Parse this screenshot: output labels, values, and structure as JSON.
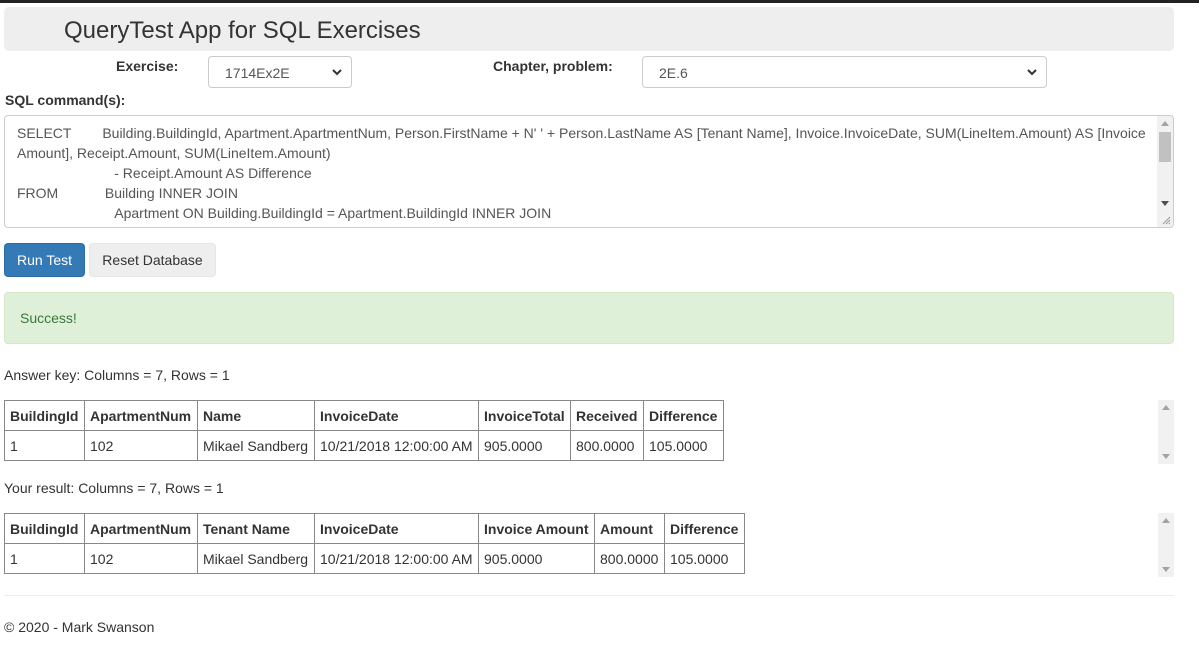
{
  "app": {
    "title": "QueryTest App for SQL Exercises"
  },
  "exercise": {
    "label": "Exercise:",
    "selected": "1714Ex2E"
  },
  "chapter": {
    "label": "Chapter, problem:",
    "selected": "2E.6"
  },
  "sql": {
    "label": "SQL command(s):",
    "text": "SELECT        Building.BuildingId, Apartment.ApartmentNum, Person.FirstName + N' ' + Person.LastName AS [Tenant Name], Invoice.InvoiceDate, SUM(LineItem.Amount) AS [Invoice Amount], Receipt.Amount, SUM(LineItem.Amount)\n                         - Receipt.Amount AS Difference\nFROM            Building INNER JOIN\n                         Apartment ON Building.BuildingId = Apartment.BuildingId INNER JOIN\n                         Person ON Apartment.TenantId = Person.PersonId INNER JOIN"
  },
  "buttons": {
    "run": "Run Test",
    "reset": "Reset Database"
  },
  "alert": {
    "text": "Success!"
  },
  "answer_key": {
    "caption": "Answer key: Columns = 7, Rows = 1",
    "headers": [
      "BuildingId",
      "ApartmentNum",
      "Name",
      "InvoiceDate",
      "InvoiceTotal",
      "Received",
      "Difference"
    ],
    "rows": [
      [
        "1",
        "102",
        "Mikael Sandberg",
        "10/21/2018 12:00:00 AM",
        "905.0000",
        "800.0000",
        "105.0000"
      ]
    ]
  },
  "your_result": {
    "caption": "Your result: Columns = 7, Rows = 1",
    "headers": [
      "BuildingId",
      "ApartmentNum",
      "Tenant Name",
      "InvoiceDate",
      "Invoice Amount",
      "Amount",
      "Difference"
    ],
    "rows": [
      [
        "1",
        "102",
        "Mikael Sandberg",
        "10/21/2018 12:00:00 AM",
        "905.0000",
        "800.0000",
        "105.0000"
      ]
    ]
  },
  "footer": {
    "text": "© 2020 - Mark Swanson"
  }
}
